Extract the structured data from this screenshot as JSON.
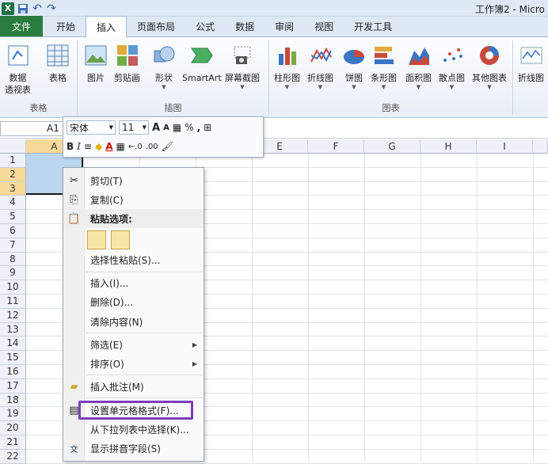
{
  "window": {
    "title": "工作簿2 - Micro"
  },
  "qat": {
    "excel_icon": "X",
    "save_icon": "save-icon",
    "undo_icon": "↶",
    "redo_icon": "↷"
  },
  "tabs": [
    {
      "label": "文件"
    },
    {
      "label": "开始"
    },
    {
      "label": "插入"
    },
    {
      "label": "页面布局"
    },
    {
      "label": "公式"
    },
    {
      "label": "数据"
    },
    {
      "label": "审阅"
    },
    {
      "label": "视图"
    },
    {
      "label": "开发工具"
    }
  ],
  "ribbon": {
    "groups": {
      "tables": "表格",
      "illustrations": "插图",
      "charts": "图表"
    },
    "buttons": {
      "pivot": {
        "label1": "数据",
        "label2": "透视表"
      },
      "table": "表格",
      "picture": "图片",
      "clipart": "剪贴画",
      "shapes": "形状",
      "smartart": "SmartArt",
      "screenshot": "屏幕截图",
      "column": "柱形图",
      "line": "折线图",
      "pie": "饼图",
      "bar": "条形图",
      "area": "面积图",
      "scatter": "散点图",
      "other": "其他图表",
      "sparkline": "折线图"
    }
  },
  "formula_bar": {
    "name_box": "A1"
  },
  "mini_toolbar": {
    "font_name": "宋体",
    "font_size": "11",
    "grow": "A",
    "shrink": "A",
    "percent": "%",
    "comma": ",",
    "bold": "B",
    "italic": "I",
    "dec_inc": "←.0",
    "dec_dec": ".00"
  },
  "columns": [
    "A",
    "B",
    "C",
    "D",
    "E",
    "F",
    "G",
    "H",
    "I"
  ],
  "rows": [
    "1",
    "2",
    "3",
    "4",
    "5",
    "6",
    "7",
    "8",
    "9",
    "10",
    "11",
    "12",
    "13",
    "14",
    "15",
    "16",
    "17",
    "18",
    "19",
    "20",
    "21",
    "22"
  ],
  "context_menu": {
    "cut": "剪切(T)",
    "copy": "复制(C)",
    "paste_options": "粘贴选项:",
    "paste_special": "选择性粘贴(S)...",
    "insert": "插入(I)...",
    "delete": "删除(D)...",
    "clear": "清除内容(N)",
    "filter": "筛选(E)",
    "sort": "排序(O)",
    "comment": "插入批注(M)",
    "format_cells": "设置单元格格式(F)...",
    "pick_list": "从下拉列表中选择(K)...",
    "phonetic": "显示拼音字段(S)"
  },
  "colors": {
    "file_tab": "#2a7d3e",
    "selection": "#bcd6ee",
    "highlight": "#7a3fb6"
  }
}
